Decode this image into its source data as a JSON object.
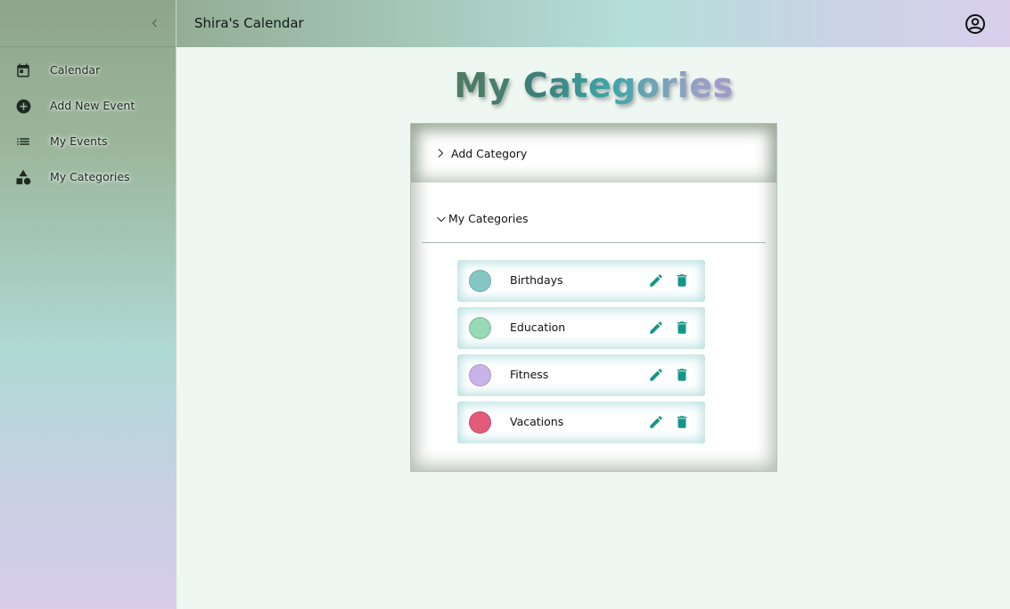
{
  "header": {
    "title": "Shira's Calendar",
    "account_icon": "account-circle-icon"
  },
  "sidebar": {
    "collapse_icon": "chevron-left-icon",
    "items": [
      {
        "label": "Calendar",
        "icon": "calendar-icon"
      },
      {
        "label": "Add New Event",
        "icon": "add-circle-icon"
      },
      {
        "label": "My Events",
        "icon": "list-icon"
      },
      {
        "label": "My Categories",
        "icon": "category-shapes-icon"
      }
    ]
  },
  "main": {
    "page_title": "My Categories",
    "add_category": {
      "label": "Add Category",
      "expanded": false
    },
    "categories_section": {
      "label": "My Categories",
      "expanded": true
    },
    "categories": [
      {
        "name": "Birthdays",
        "color": "#85c7c3"
      },
      {
        "name": "Education",
        "color": "#98d8b5"
      },
      {
        "name": "Fitness",
        "color": "#c9b3e8"
      },
      {
        "name": "Vacations",
        "color": "#e45a7d"
      }
    ],
    "action_color": "#14968a"
  }
}
